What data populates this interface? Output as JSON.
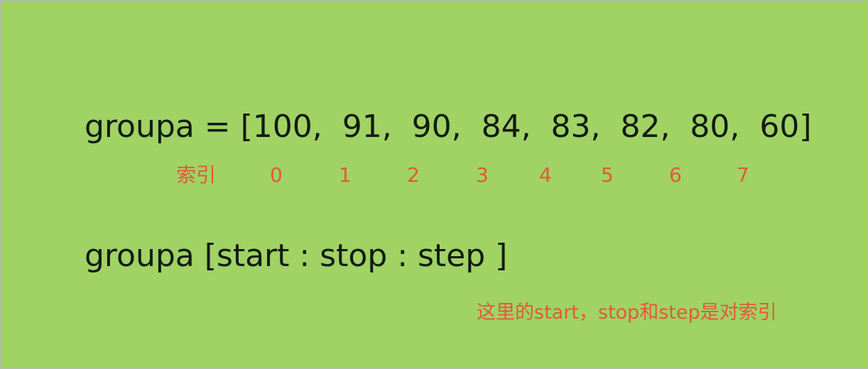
{
  "array_line": "groupa = [100,  91,  90,  84,  83,  82,  80,  60]",
  "index_label": "索引",
  "indices": [
    "0",
    "1",
    "2",
    "3",
    "4",
    "5",
    "6",
    "7"
  ],
  "slice_line": "groupa [start : stop : step ]",
  "note": "这里的start，stop和step是对索引",
  "colors": {
    "background": "#a0d264",
    "code_text": "#111a11",
    "annotation": "#e05a3a"
  }
}
